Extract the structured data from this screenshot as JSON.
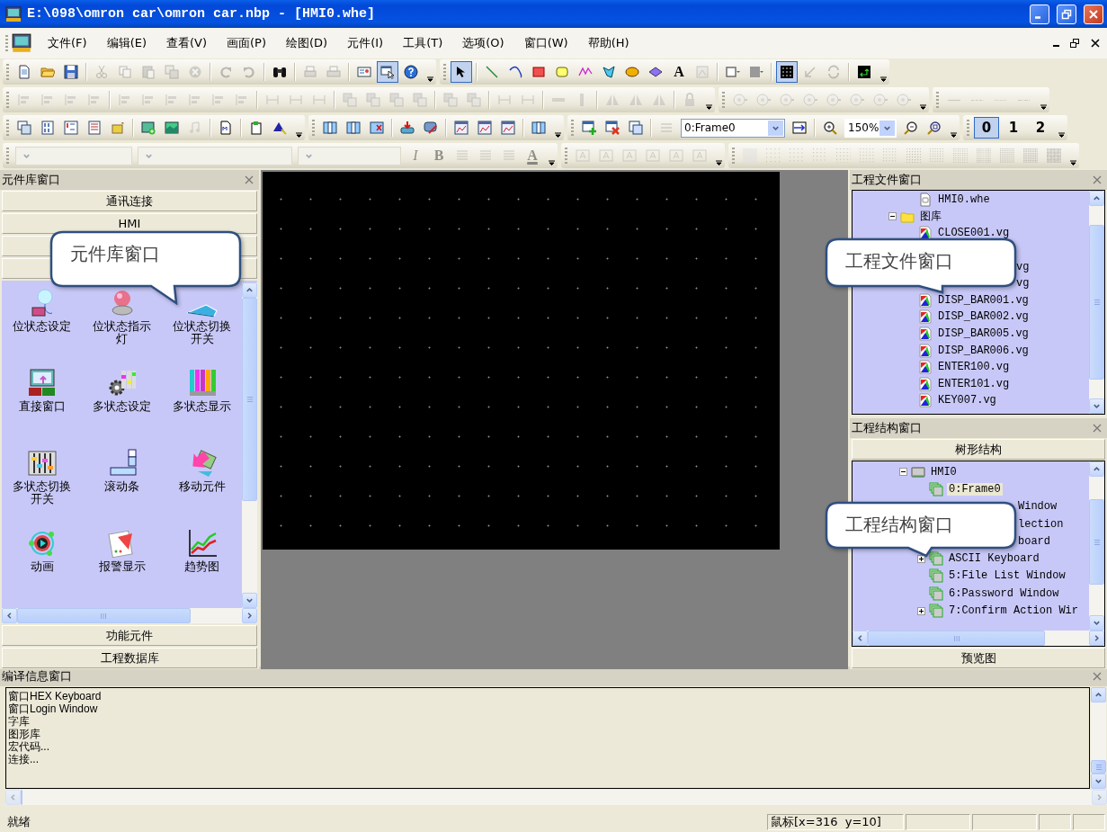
{
  "window": {
    "title": "E:\\098\\omron car\\omron car.nbp - [HMI0.whe]"
  },
  "menu": [
    {
      "label": "文件(F)"
    },
    {
      "label": "编辑(E)"
    },
    {
      "label": "查看(V)"
    },
    {
      "label": "画面(P)"
    },
    {
      "label": "绘图(D)"
    },
    {
      "label": "元件(I)"
    },
    {
      "label": "工具(T)"
    },
    {
      "label": "选项(O)"
    },
    {
      "label": "窗口(W)"
    },
    {
      "label": "帮助(H)"
    }
  ],
  "toolbars": [
    {
      "bands": [
        {
          "groups": [
            [
              {
                "kind": "new",
                "disabled": false,
                "on": false
              },
              {
                "kind": "open",
                "disabled": false,
                "on": false
              },
              {
                "kind": "save",
                "disabled": false,
                "on": false
              }
            ],
            [
              {
                "kind": "cut",
                "disabled": true,
                "on": false
              },
              {
                "kind": "copy",
                "disabled": true,
                "on": false
              },
              {
                "kind": "paste",
                "disabled": true,
                "on": false
              },
              {
                "kind": "clone",
                "disabled": true,
                "on": false
              },
              {
                "kind": "delete",
                "disabled": true,
                "on": false
              }
            ],
            [
              {
                "kind": "redo",
                "disabled": true,
                "on": false
              },
              {
                "kind": "undo",
                "disabled": true,
                "on": false
              }
            ],
            [
              {
                "kind": "find",
                "disabled": false,
                "on": false
              }
            ],
            [
              {
                "kind": "printpreview",
                "disabled": true,
                "on": false
              },
              {
                "kind": "print",
                "disabled": true,
                "on": false
              }
            ],
            [
              {
                "kind": "card",
                "disabled": false,
                "on": false
              },
              {
                "kind": "preview",
                "disabled": false,
                "on": true
              },
              {
                "kind": "help",
                "disabled": false,
                "on": false
              }
            ]
          ]
        },
        {
          "groups": [
            [
              {
                "kind": "select",
                "disabled": false,
                "on": true
              }
            ],
            [
              {
                "kind": "line",
                "disabled": false,
                "on": false
              },
              {
                "kind": "arc",
                "disabled": false,
                "on": false
              },
              {
                "kind": "rect",
                "disabled": false,
                "on": false
              },
              {
                "kind": "roundrect",
                "disabled": false,
                "on": false
              },
              {
                "kind": "polyline",
                "disabled": false,
                "on": false
              },
              {
                "kind": "polygon",
                "disabled": false,
                "on": false
              },
              {
                "kind": "ellipse",
                "disabled": false,
                "on": false
              },
              {
                "kind": "diamond",
                "disabled": false,
                "on": false
              },
              {
                "kind": "letter",
                "label": "A",
                "disabled": false,
                "on": false
              },
              {
                "kind": "bitmap",
                "disabled": true,
                "on": false
              }
            ],
            [
              {
                "kind": "linecolor",
                "disabled": false,
                "on": false
              },
              {
                "kind": "fillcolor",
                "disabled": false,
                "on": false
              }
            ],
            [
              {
                "kind": "grid",
                "disabled": false,
                "on": true
              },
              {
                "kind": "arrowdl",
                "disabled": true,
                "on": false
              },
              {
                "kind": "refresh",
                "disabled": true,
                "on": false
              }
            ],
            [
              {
                "kind": "screen",
                "disabled": false,
                "on": false
              }
            ]
          ]
        }
      ]
    },
    {
      "bands": [
        {
          "groups": [
            [
              {
                "kind": "align",
                "disabled": true,
                "on": false
              },
              {
                "kind": "align",
                "disabled": true,
                "on": false
              },
              {
                "kind": "align",
                "disabled": true,
                "on": false
              },
              {
                "kind": "align",
                "disabled": true,
                "on": false
              }
            ],
            [
              {
                "kind": "align",
                "disabled": true,
                "on": false
              },
              {
                "kind": "align",
                "disabled": true,
                "on": false
              },
              {
                "kind": "align",
                "disabled": true,
                "on": false
              },
              {
                "kind": "align",
                "disabled": true,
                "on": false
              },
              {
                "kind": "align",
                "disabled": true,
                "on": false
              },
              {
                "kind": "align",
                "disabled": true,
                "on": false
              }
            ],
            [
              {
                "kind": "size",
                "disabled": true,
                "on": false
              },
              {
                "kind": "size",
                "disabled": true,
                "on": false
              },
              {
                "kind": "size",
                "disabled": true,
                "on": false
              }
            ],
            [
              {
                "kind": "order",
                "disabled": true,
                "on": false
              },
              {
                "kind": "order",
                "disabled": true,
                "on": false
              },
              {
                "kind": "order",
                "disabled": true,
                "on": false
              },
              {
                "kind": "order",
                "disabled": true,
                "on": false
              }
            ],
            [
              {
                "kind": "order",
                "disabled": true,
                "on": false
              },
              {
                "kind": "order",
                "disabled": true,
                "on": false
              }
            ],
            [
              {
                "kind": "size",
                "disabled": true,
                "on": false
              },
              {
                "kind": "size",
                "disabled": true,
                "on": false
              }
            ],
            [
              {
                "kind": "hbar",
                "disabled": true,
                "on": false
              },
              {
                "kind": "vbar",
                "disabled": true,
                "on": false
              }
            ],
            [
              {
                "kind": "flip",
                "disabled": true,
                "on": false
              },
              {
                "kind": "flip",
                "disabled": true,
                "on": false
              },
              {
                "kind": "flip",
                "disabled": true,
                "on": false
              }
            ],
            [
              {
                "kind": "lock",
                "disabled": true,
                "on": false
              }
            ]
          ]
        },
        {
          "groups": [
            [
              {
                "kind": "circlenum",
                "disabled": true,
                "on": false
              },
              {
                "kind": "circlenum",
                "disabled": true,
                "on": false
              },
              {
                "kind": "circlenum",
                "disabled": true,
                "on": false
              },
              {
                "kind": "circlenum",
                "disabled": true,
                "on": false
              },
              {
                "kind": "circlenum",
                "disabled": true,
                "on": false
              },
              {
                "kind": "circlenum",
                "disabled": true,
                "on": false
              },
              {
                "kind": "circlenum",
                "disabled": true,
                "on": false
              },
              {
                "kind": "circlenum",
                "disabled": true,
                "on": false
              }
            ]
          ]
        },
        {
          "groups": [
            [
              {
                "kind": "dash",
                "disabled": true,
                "on": false
              },
              {
                "kind": "dash",
                "disabled": true,
                "on": false
              },
              {
                "kind": "dash",
                "disabled": true,
                "on": false
              },
              {
                "kind": "dash",
                "disabled": true,
                "on": false
              }
            ]
          ]
        }
      ]
    },
    {
      "bands": [
        {
          "groups": [
            [
              {
                "kind": "layers",
                "disabled": false,
                "on": false
              },
              {
                "kind": "binary",
                "disabled": false,
                "on": false
              },
              {
                "kind": "alarmtext",
                "disabled": false,
                "on": false
              },
              {
                "kind": "list",
                "disabled": false,
                "on": false
              },
              {
                "kind": "gold",
                "disabled": false,
                "on": false
              }
            ],
            [
              {
                "kind": "addimage",
                "disabled": false,
                "on": false
              },
              {
                "kind": "image",
                "disabled": false,
                "on": false
              },
              {
                "kind": "music",
                "disabled": true,
                "on": false
              }
            ],
            [
              {
                "kind": "mdoc",
                "disabled": false,
                "on": false
              }
            ],
            [
              {
                "kind": "clipdoc",
                "disabled": false,
                "on": false
              },
              {
                "kind": "triangle",
                "disabled": false,
                "on": false
              }
            ]
          ]
        },
        {
          "groups": [
            [
              {
                "kind": "split",
                "disabled": false,
                "on": false
              },
              {
                "kind": "split",
                "disabled": false,
                "on": false
              },
              {
                "kind": "splitx",
                "disabled": false,
                "on": false
              }
            ],
            [
              {
                "kind": "download",
                "disabled": false,
                "on": false
              },
              {
                "kind": "tools",
                "disabled": false,
                "on": false
              }
            ],
            [
              {
                "kind": "trend",
                "disabled": false,
                "on": false
              },
              {
                "kind": "trend",
                "disabled": false,
                "on": false
              },
              {
                "kind": "trend",
                "disabled": false,
                "on": false
              }
            ],
            [
              {
                "kind": "split",
                "disabled": false,
                "on": false
              }
            ]
          ]
        },
        {
          "groups": [
            [
              {
                "kind": "addwin",
                "disabled": false,
                "on": false
              },
              {
                "kind": "delwin",
                "disabled": false,
                "on": false
              },
              {
                "kind": "copywin",
                "disabled": false,
                "on": false
              }
            ],
            [
              {
                "kind": "framelist",
                "disabled": true,
                "on": false
              },
              {
                "kind": "framecombo",
                "value": "0:Frame0",
                "disabled": false
              },
              {
                "kind": "goto",
                "disabled": false,
                "on": false
              }
            ],
            [
              {
                "kind": "zoomin",
                "disabled": false,
                "on": false
              },
              {
                "kind": "zoomcombo",
                "value": "150%",
                "disabled": false
              },
              {
                "kind": "zoomout",
                "disabled": false,
                "on": false
              },
              {
                "kind": "zoomfit",
                "disabled": false,
                "on": false
              }
            ]
          ]
        },
        {
          "groups": [
            [
              {
                "kind": "layer",
                "label": "0",
                "disabled": false,
                "on": true
              },
              {
                "kind": "layer",
                "label": "1",
                "disabled": false,
                "on": false
              },
              {
                "kind": "layer",
                "label": "2",
                "disabled": false,
                "on": false
              }
            ]
          ]
        }
      ]
    },
    {
      "bands": [
        {
          "groups": [
            [
              {
                "kind": "fontcombo",
                "disabled": true
              },
              {
                "kind": "stylecombo",
                "disabled": true
              },
              {
                "kind": "sizecombo",
                "disabled": true
              },
              {
                "kind": "italic",
                "label": "I",
                "disabled": true,
                "on": false
              },
              {
                "kind": "bold",
                "label": "B",
                "disabled": true,
                "on": false
              },
              {
                "kind": "textalign",
                "disabled": true,
                "on": false
              },
              {
                "kind": "textalign",
                "disabled": true,
                "on": false
              },
              {
                "kind": "textalign",
                "disabled": true,
                "on": false
              },
              {
                "kind": "colorletter",
                "label": "A",
                "disabled": true,
                "on": false
              }
            ]
          ]
        },
        {
          "groups": [
            [
              {
                "kind": "textbox",
                "disabled": true,
                "on": false
              },
              {
                "kind": "textbox",
                "disabled": true,
                "on": false
              },
              {
                "kind": "textbox",
                "disabled": true,
                "on": false
              },
              {
                "kind": "textbox",
                "disabled": true,
                "on": false
              },
              {
                "kind": "textbox",
                "disabled": true,
                "on": false
              },
              {
                "kind": "textbox",
                "disabled": true,
                "on": false
              }
            ]
          ]
        },
        {
          "groups": [
            [
              {
                "kind": "pattern",
                "disabled": true,
                "on": false
              },
              {
                "kind": "pattern",
                "disabled": true,
                "on": false
              },
              {
                "kind": "pattern",
                "disabled": true,
                "on": false
              },
              {
                "kind": "pattern",
                "disabled": true,
                "on": false
              },
              {
                "kind": "pattern",
                "disabled": true,
                "on": false
              },
              {
                "kind": "pattern",
                "disabled": true,
                "on": false
              },
              {
                "kind": "pattern",
                "disabled": true,
                "on": false
              },
              {
                "kind": "pattern",
                "disabled": true,
                "on": false
              },
              {
                "kind": "pattern",
                "disabled": true,
                "on": false
              },
              {
                "kind": "pattern",
                "disabled": true,
                "on": false
              },
              {
                "kind": "pattern",
                "disabled": true,
                "on": false
              },
              {
                "kind": "pattern",
                "disabled": true,
                "on": false
              },
              {
                "kind": "pattern",
                "disabled": true,
                "on": false
              },
              {
                "kind": "pattern",
                "disabled": true,
                "on": false
              }
            ]
          ]
        }
      ]
    }
  ],
  "library": {
    "title": "元件库窗口",
    "top_tabs": [
      {
        "kind": "tab",
        "label": "通讯连接"
      },
      {
        "kind": "tab",
        "label": "HMI"
      },
      {
        "kind": "covered"
      },
      {
        "kind": "covered"
      }
    ],
    "components": [
      {
        "kind": "lamp",
        "label": "位状态设定"
      },
      {
        "kind": "indicator",
        "label": "位状态指示灯"
      },
      {
        "kind": "toggle",
        "label": "位状态切换开关"
      },
      {
        "kind": "window",
        "label": "直接窗口"
      },
      {
        "kind": "gearbars",
        "label": "多状态设定"
      },
      {
        "kind": "colorbars",
        "label": "多状态显示"
      },
      {
        "kind": "sliders",
        "label": "多状态切换开关"
      },
      {
        "kind": "scroll",
        "label": "滚动条"
      },
      {
        "kind": "move",
        "label": "移动元件"
      },
      {
        "kind": "play",
        "label": "动画"
      },
      {
        "kind": "alarm",
        "label": "报警显示"
      },
      {
        "kind": "trend",
        "label": "趋势图"
      }
    ],
    "bottom_tabs": [
      {
        "label": "功能元件"
      },
      {
        "label": "工程数据库"
      }
    ],
    "callout": {
      "text": "元件库窗口"
    }
  },
  "project_files": {
    "title": "工程文件窗口",
    "tree": [
      {
        "kind": "file",
        "label": "HMI0.whe"
      },
      {
        "kind": "folder",
        "label": "图库",
        "expanded": true,
        "children": [
          {
            "kind": "image",
            "label": "CLOSE001.vg"
          },
          {
            "kind": "tail",
            "label": "vg"
          },
          {
            "kind": "tail",
            "label": "vg"
          },
          {
            "kind": "image",
            "label": "DISP_BAR001.vg"
          },
          {
            "kind": "image",
            "label": "DISP_BAR002.vg"
          },
          {
            "kind": "image",
            "label": "DISP_BAR005.vg"
          },
          {
            "kind": "image",
            "label": "DISP_BAR006.vg"
          },
          {
            "kind": "image",
            "label": "ENTER100.vg"
          },
          {
            "kind": "image",
            "label": "ENTER101.vg"
          },
          {
            "kind": "image",
            "label": "KEY007.vg"
          }
        ]
      }
    ],
    "callout": {
      "text": "工程文件窗口"
    }
  },
  "project_structure": {
    "title": "工程结构窗口",
    "tab": "树形结构",
    "tree": [
      {
        "kind": "hmi",
        "label": "HMI0",
        "expanded": true,
        "selected": false,
        "children": [
          {
            "kind": "frame",
            "label": "0:Frame0",
            "selected": true
          },
          {
            "kind": "tail",
            "label": "Window",
            "selected": false
          },
          {
            "kind": "tail",
            "label": "lection",
            "selected": false
          },
          {
            "kind": "tail",
            "label": "board",
            "selected": false
          },
          {
            "kind": "frame",
            "label": "ASCII Keyboard",
            "expanded": false,
            "selected": false
          },
          {
            "kind": "frame",
            "label": "5:File List Window",
            "selected": false
          },
          {
            "kind": "frame",
            "label": "6:Password Window",
            "selected": false
          },
          {
            "kind": "frame",
            "label": "7:Confirm Action Wir",
            "expanded": false,
            "selected": false
          }
        ]
      }
    ],
    "bottom_tab": "预览图",
    "callout": {
      "text": "工程结构窗口"
    }
  },
  "output": {
    "title": "编译信息窗口",
    "lines": [
      "窗口HEX Keyboard",
      "窗口Login Window",
      "字库",
      "图形库",
      "宏代码...",
      "连接..."
    ]
  },
  "status_bar": {
    "message": "就绪",
    "mouse": "鼠标[x=316  y=10]"
  }
}
